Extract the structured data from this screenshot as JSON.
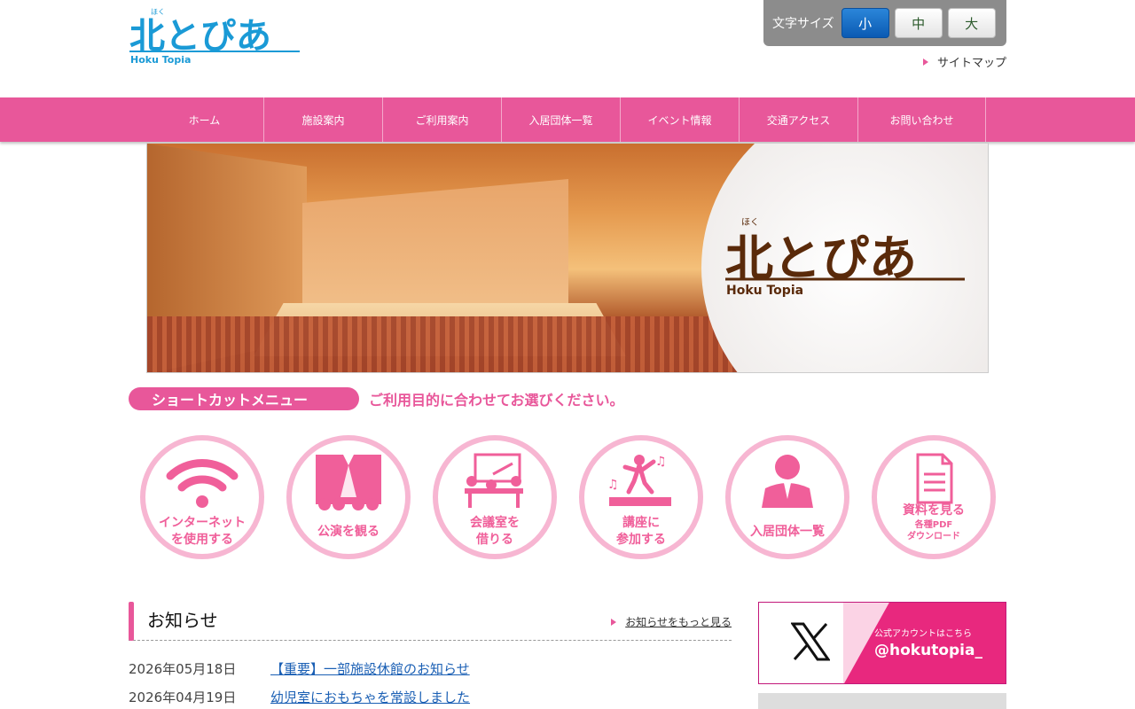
{
  "header": {
    "logo_furigana": "ほく",
    "logo_text": "北とぴあ",
    "logo_sub": "Hoku Topia",
    "font_size_label": "文字サイズ",
    "font_sizes": [
      "小",
      "中",
      "大"
    ],
    "selected_font_size": "小",
    "sitemap_label": "サイトマップ"
  },
  "nav": {
    "items": [
      "ホーム",
      "施設案内",
      "ご利用案内",
      "入居団体一覧",
      "イベント情報",
      "交通アクセス",
      "お問い合わせ"
    ]
  },
  "hero": {
    "logo_furigana": "ほく",
    "logo_text": "北とぴあ",
    "logo_sub": "Hoku Topia"
  },
  "shortcut": {
    "title": "ショートカットメニュー",
    "subtitle": "ご利用目的に合わせてお選びください。",
    "items": [
      {
        "line1": "インターネット",
        "line2": "を使用する",
        "icon": "wifi-icon"
      },
      {
        "line1": "公演を観る",
        "line2": "",
        "icon": "stage-icon"
      },
      {
        "line1": "会議室を",
        "line2": "借りる",
        "icon": "meeting-icon"
      },
      {
        "line1": "講座に",
        "line2": "参加する",
        "icon": "dance-icon"
      },
      {
        "line1": "入居団体一覧",
        "line2": "",
        "icon": "person-icon"
      },
      {
        "line1": "資料を見る",
        "line2": "各種PDF",
        "line3": "ダウンロード",
        "icon": "document-icon"
      }
    ]
  },
  "news": {
    "title": "お知らせ",
    "more_label": "お知らせをもっと見る",
    "items": [
      {
        "date": "2026年05月18日",
        "text": "【重要】一部施設休館のお知らせ"
      },
      {
        "date": "2026年04月19日",
        "text": "幼児室におもちゃを常設しました"
      }
    ]
  },
  "x_banner": {
    "line1": "公式アカウントはこちら",
    "handle": "@hokutopia_"
  },
  "colors": {
    "accent_pink": "#e8579a",
    "link_blue": "#1a5fb4",
    "logo_blue": "#1a9ad6",
    "hero_logo_brown": "#5a2a0a"
  }
}
